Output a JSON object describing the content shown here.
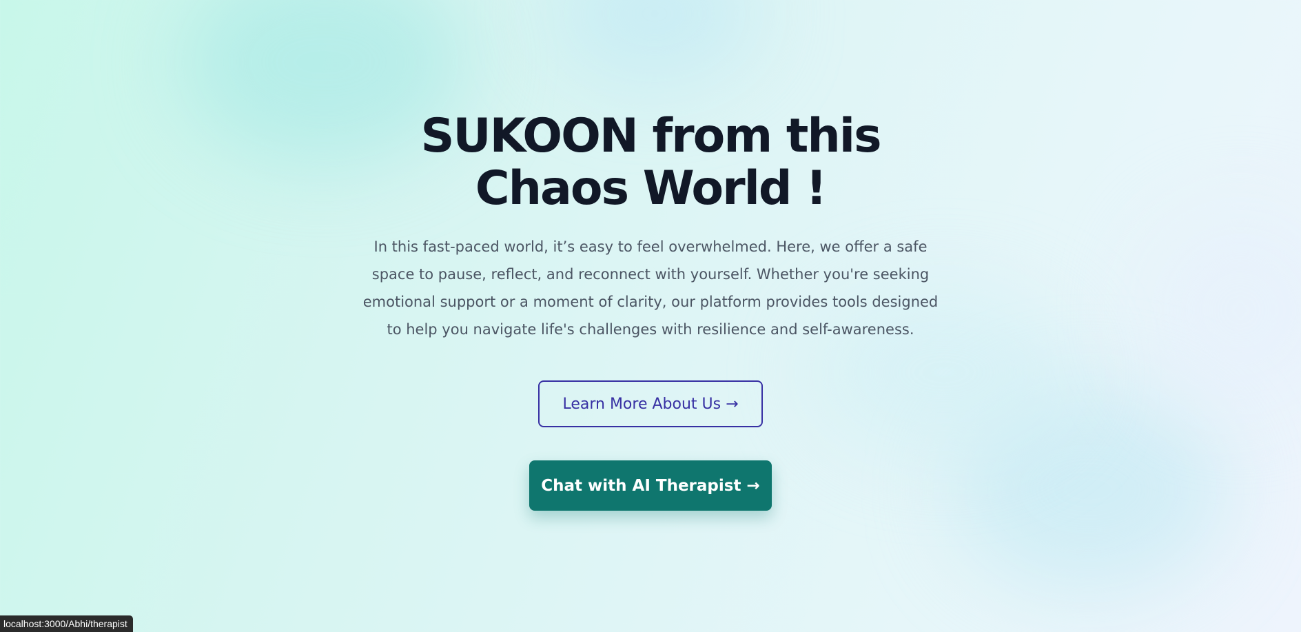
{
  "hero": {
    "headline": "SUKOON from this Chaos World !",
    "description": "In this fast-paced world, it’s easy to feel overwhelmed. Here, we offer a safe space to pause, reflect, and reconnect with yourself. Whether you're seeking emotional support or a moment of clarity, our platform provides tools designed to help you navigate life's challenges with resilience and self-awareness.",
    "learn_more_label": "Learn More About Us →",
    "chat_label": "Chat with AI Therapist →"
  },
  "status_bar": {
    "url": "localhost:3000/Abhi/therapist"
  },
  "colors": {
    "headline": "#111827",
    "body_text": "#4b5563",
    "learn_more": "#3730a3",
    "chat_button": "#0f766e",
    "background_start": "#c8f7ea",
    "background_end": "#eef4fd"
  }
}
